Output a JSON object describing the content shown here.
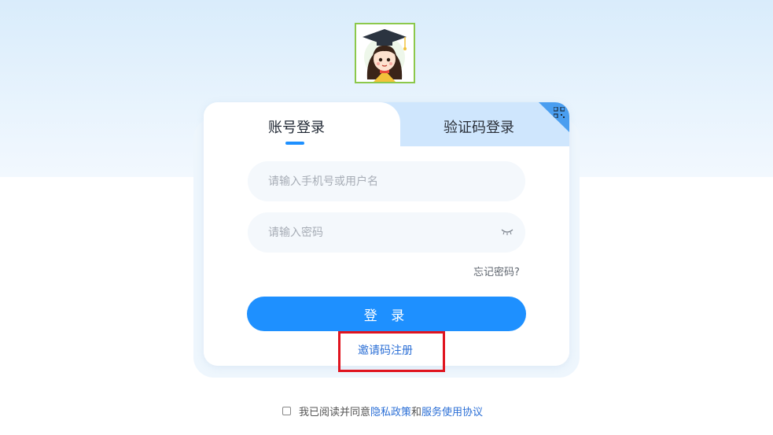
{
  "tabs": {
    "account": "账号登录",
    "sms": "验证码登录"
  },
  "fields": {
    "username_placeholder": "请输入手机号或用户名",
    "password_placeholder": "请输入密码"
  },
  "forgot_password": "忘记密码?",
  "login_button": "登 录",
  "invite_register": "邀请码注册",
  "agreement": {
    "prefix": "我已阅读并同意",
    "privacy": "隐私政策",
    "and": "和",
    "terms": "服务使用协议"
  },
  "icons": {
    "avatar": "graduate-avatar-icon",
    "qr": "qr-code-icon",
    "eye": "eye-closed-icon"
  },
  "colors": {
    "primary": "#1e90ff",
    "highlight": "#e0141f"
  }
}
